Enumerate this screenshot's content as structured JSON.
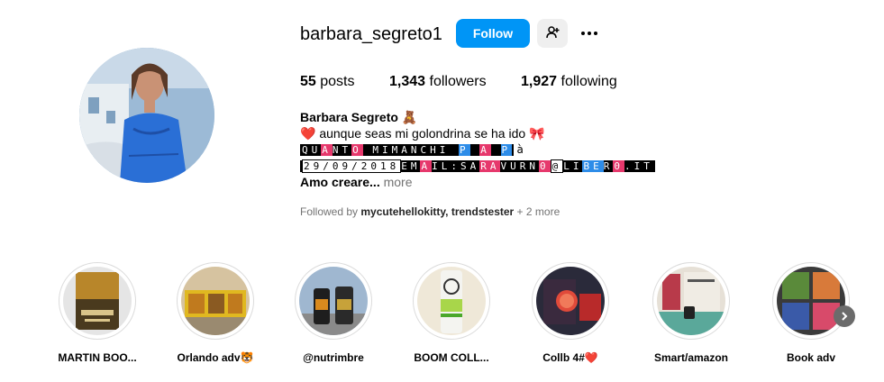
{
  "profile": {
    "username": "barbara_segreto1",
    "follow_label": "Follow",
    "suggest_icon": "person-plus-icon",
    "more_icon": "ellipsis-icon",
    "stats": {
      "posts_count": "55",
      "posts_label": "posts",
      "followers_count": "1,343",
      "followers_label": "followers",
      "following_count": "1,927",
      "following_label": "following"
    },
    "full_name": "Barbara Segreto",
    "name_emoji": "🧸",
    "bio": {
      "line1_heart": "❤️",
      "line1_text": "aunque seas mi golondrina se ha ido",
      "line1_bow": "🎀",
      "line2_a": "QU",
      "line2_b": "A",
      "line2_c": "NT",
      "line2_d": "O",
      "line2_e": "MIMA",
      "line2_f": "NCHI",
      "line2_g": "P",
      "line2_h": "A",
      "line2_i": "P",
      "line2_tail": "à",
      "line3_date": "29/09/2018",
      "line3_em": "EM",
      "line3_a": "A",
      "line3_il": "IL:SA",
      "line3_ra": "RA",
      "line3_vurn": "VURN",
      "line3_zero": "0",
      "line3_at": "@",
      "line3_li": "LI",
      "line3_be": "BE",
      "line3_r": "R",
      "line3_zero2": "0",
      "line3_it": ".IT",
      "more_text": "Amo creare...",
      "more_link": "more"
    },
    "followed_by_prefix": "Followed by",
    "followed_by_names": "mycutehellokitty, trendstester",
    "followed_by_more": "+ 2 more"
  },
  "highlights": [
    {
      "label": "MARTIN BOO..."
    },
    {
      "label": "Orlando adv🐯"
    },
    {
      "label": "@nutrimbre"
    },
    {
      "label": "BOOM COLL..."
    },
    {
      "label": "Collb 4#❤️"
    },
    {
      "label": "Smart/amazon"
    },
    {
      "label": "Book adv"
    }
  ],
  "next_icon": "chevron-right-icon",
  "colors": {
    "accent": "#0095f6",
    "secondary_button": "#efefef",
    "muted_text": "#737373",
    "ring_border": "#dbdbdb"
  }
}
